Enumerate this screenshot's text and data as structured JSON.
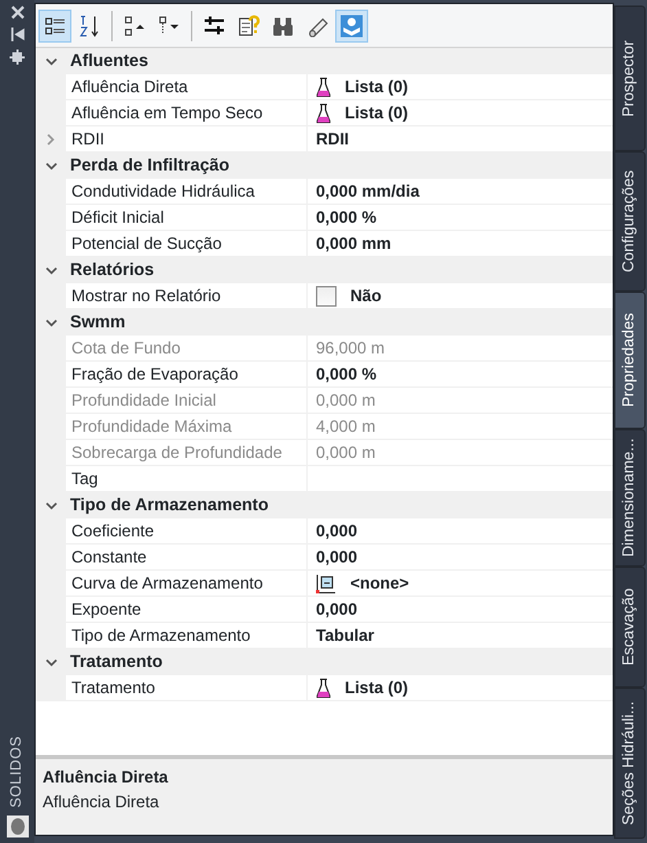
{
  "side_strip": {
    "label": "SOLIDOS"
  },
  "toolbar": [
    {
      "kind": "categorized",
      "selected": true
    },
    {
      "kind": "alphabetical",
      "selected": false
    },
    {
      "kind": "sep"
    },
    {
      "kind": "collapse",
      "selected": false
    },
    {
      "kind": "expand",
      "selected": false
    },
    {
      "kind": "sep"
    },
    {
      "kind": "properties",
      "selected": false
    },
    {
      "kind": "help",
      "selected": false
    },
    {
      "kind": "find",
      "selected": false
    },
    {
      "kind": "pipe",
      "selected": false
    },
    {
      "kind": "network",
      "selected": true
    }
  ],
  "categories": [
    {
      "title": "Afluentes",
      "expanded": true,
      "properties": [
        {
          "label": "Afluência Direta",
          "value": "Lista (0)",
          "kind": "flask",
          "disabled": false
        },
        {
          "label": "Afluência em Tempo Seco",
          "value": "Lista (0)",
          "kind": "flask",
          "disabled": false
        },
        {
          "label": "RDII",
          "value": "RDII",
          "kind": "group",
          "expanded": false,
          "disabled": false
        }
      ]
    },
    {
      "title": "Perda de Infiltração",
      "expanded": true,
      "properties": [
        {
          "label": "Condutividade Hidráulica",
          "value": "0,000 mm/dia",
          "kind": "text",
          "disabled": false
        },
        {
          "label": "Déficit Inicial",
          "value": "0,000 %",
          "kind": "text",
          "disabled": false
        },
        {
          "label": "Potencial de Sucção",
          "value": "0,000 mm",
          "kind": "text",
          "disabled": false
        }
      ]
    },
    {
      "title": "Relatórios",
      "expanded": true,
      "properties": [
        {
          "label": "Mostrar no Relatório",
          "value": "Não",
          "kind": "checkbox",
          "checked": false,
          "disabled": false
        }
      ]
    },
    {
      "title": "Swmm",
      "expanded": true,
      "properties": [
        {
          "label": "Cota de Fundo",
          "value": "96,000 m",
          "kind": "text",
          "disabled": true
        },
        {
          "label": "Fração de Evaporação",
          "value": "0,000 %",
          "kind": "text",
          "disabled": false
        },
        {
          "label": "Profundidade Inicial",
          "value": "0,000 m",
          "kind": "text",
          "disabled": true
        },
        {
          "label": "Profundidade Máxima",
          "value": "4,000 m",
          "kind": "text",
          "disabled": true
        },
        {
          "label": "Sobrecarga de Profundidade",
          "value": "0,000 m",
          "kind": "text",
          "disabled": true
        },
        {
          "label": "Tag",
          "kind": "text",
          "disabled": false
        }
      ]
    },
    {
      "title": "Tipo de Armazenamento",
      "expanded": true,
      "properties": [
        {
          "label": "Coeficiente",
          "value": "0,000",
          "kind": "text",
          "disabled": false
        },
        {
          "label": "Constante",
          "value": "0,000",
          "kind": "text",
          "disabled": false
        },
        {
          "label": "Curva de Armazenamento",
          "value": "<none>",
          "kind": "curve",
          "disabled": false
        },
        {
          "label": "Expoente",
          "value": "0,000",
          "kind": "text",
          "disabled": false
        },
        {
          "label": "Tipo de Armazenamento",
          "value": "Tabular",
          "kind": "text",
          "disabled": false
        }
      ]
    },
    {
      "title": "Tratamento",
      "expanded": true,
      "properties": [
        {
          "label": "Tratamento",
          "value": "Lista (0)",
          "kind": "flask",
          "disabled": false
        }
      ]
    }
  ],
  "description": {
    "title": "Afluência Direta",
    "text": "Afluência Direta"
  },
  "tabs": [
    {
      "label": "Prospector",
      "selected": false
    },
    {
      "label": "Configurações",
      "selected": false
    },
    {
      "label": "Propriedades",
      "selected": true
    },
    {
      "label": "Dimensioname...",
      "selected": false
    },
    {
      "label": "Escavação",
      "selected": false
    },
    {
      "label": "Seções Hidráuli...",
      "selected": false
    }
  ]
}
